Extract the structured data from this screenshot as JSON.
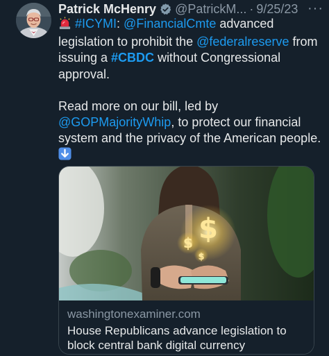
{
  "author": {
    "display_name": "Patrick McHenry",
    "handle": "@PatrickM...",
    "separator": "·",
    "date": "9/25/23",
    "avatar_icon": "person-avatar",
    "verified_icon": "verified-badge-icon"
  },
  "more_label": "···",
  "tweet": {
    "p1": {
      "siren": "🚨",
      "tag_icymi": "#ICYMI",
      "colon": ": ",
      "mention_committee": "@FinancialCmte",
      "t1": " advanced legislation to prohibit the ",
      "mention_fed": "@federalreserve",
      "t2": " from issuing a ",
      "tag_cbdc": "#CBDC",
      "t3": " without Congressional approval."
    },
    "p2": {
      "t1": "Read more on our bill, led by ",
      "mention_whip": "@GOPMajorityWhip",
      "t2": ", to protect our financial system and the privacy of the American people. ",
      "arrow": "⬇️"
    }
  },
  "card": {
    "domain": "washingtonexaminer.com",
    "title": "House Republicans advance legislation to block central bank digital currency",
    "image_alt": "hands holding a smartphone with glowing dollar signs"
  },
  "colors": {
    "background": "#15202b",
    "text": "#e7e9ea",
    "secondary": "#8b98a5",
    "link": "#1d9bf0",
    "border": "#38444d"
  }
}
